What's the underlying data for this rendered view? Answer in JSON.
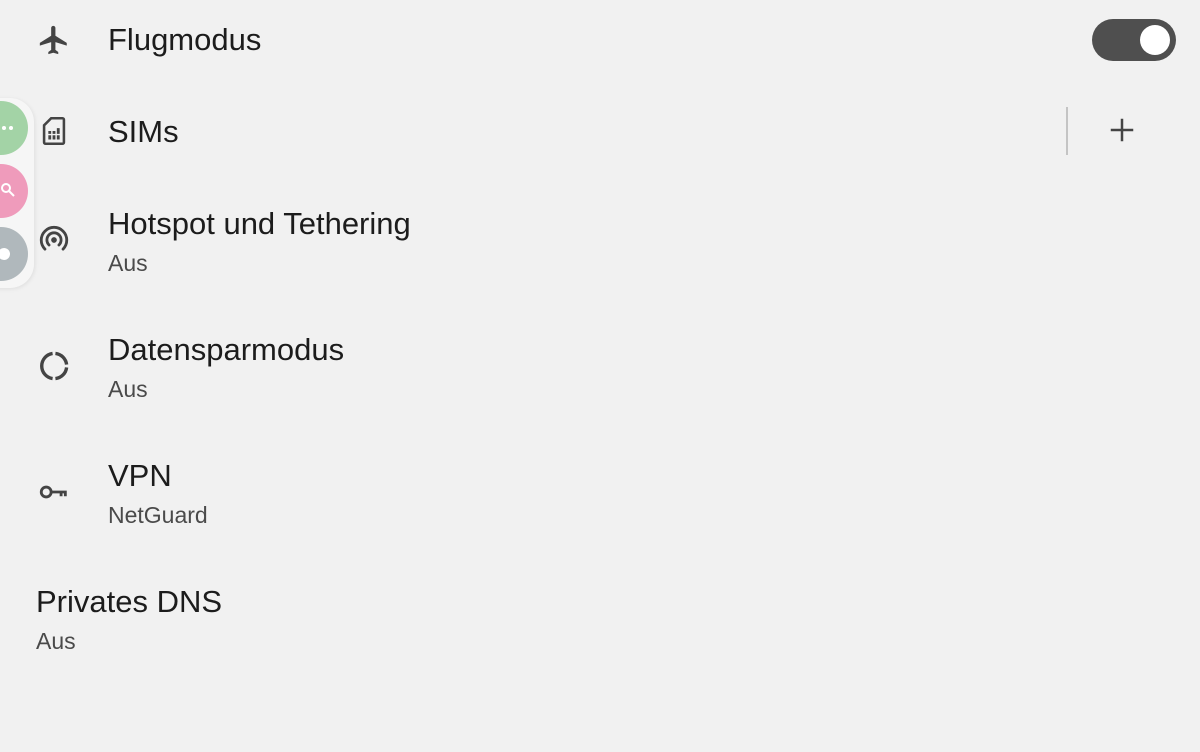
{
  "settings": {
    "airplane": {
      "title": "Flugmodus",
      "toggle_on": true
    },
    "sims": {
      "title": "SIMs"
    },
    "hotspot": {
      "title": "Hotspot und Tethering",
      "subtitle": "Aus"
    },
    "datasaver": {
      "title": "Datensparmodus",
      "subtitle": "Aus"
    },
    "vpn": {
      "title": "VPN",
      "subtitle": "NetGuard"
    },
    "private_dns": {
      "title": "Privates DNS",
      "subtitle": "Aus"
    }
  },
  "icons": {
    "airplane": "airplane-icon",
    "sim": "sim-card-icon",
    "hotspot": "hotspot-icon",
    "datasaver": "data-saver-icon",
    "vpn": "key-icon",
    "add": "plus-icon"
  },
  "side_bubbles": [
    {
      "name": "more-bubble",
      "color": "#a3d3a6"
    },
    {
      "name": "search-bubble",
      "color": "#ef9bbb"
    },
    {
      "name": "pin-bubble",
      "color": "#b0b8bc"
    }
  ],
  "colors": {
    "background": "#f1f1f1",
    "toggle_track": "#4f4f4f",
    "icon": "#444444"
  }
}
